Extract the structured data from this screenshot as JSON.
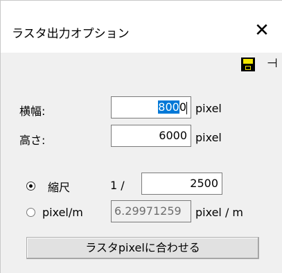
{
  "window": {
    "title": "ラスタ出力オプション",
    "close_glyph": "✕"
  },
  "toolbar": {
    "save_icon": "floppy-disk",
    "pin_icon": "pin",
    "pin_glyph": "⊣"
  },
  "width": {
    "label": "横幅:",
    "value_selected": "800",
    "value_rest": "0",
    "unit": "pixel"
  },
  "height": {
    "label": "高さ:",
    "value": "6000",
    "unit": "pixel"
  },
  "scale": {
    "label": "縮尺",
    "prefix": "1 /",
    "value": "2500",
    "selected": true
  },
  "pixel_per_m": {
    "label": "pixel/m",
    "value": "6.29971259",
    "unit": "pixel / m",
    "selected": false
  },
  "fit_button": {
    "label": "ラスタpixelに合わせる"
  }
}
